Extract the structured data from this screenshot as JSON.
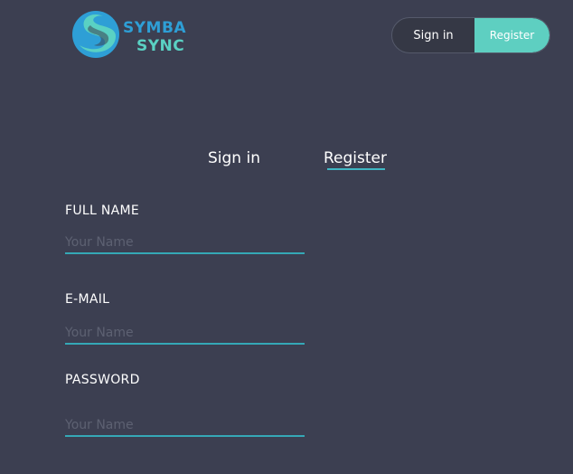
{
  "brand": {
    "line1": "SYMBA",
    "line2": "SYNC",
    "colors": {
      "blue": "#2e9fd6",
      "teal": "#5ad1c3",
      "background": "#3c3f51",
      "accent": "#35a8b6"
    }
  },
  "header_toggle": {
    "signin_label": "Sign in",
    "register_label": "Register",
    "active": "Register"
  },
  "tabs": {
    "signin_label": "Sign in",
    "register_label": "Register",
    "active": "Register"
  },
  "form": {
    "full_name": {
      "label": "FULL NAME",
      "placeholder": "Your Name",
      "value": ""
    },
    "email": {
      "label": "E-MAIL",
      "placeholder": "Your Name",
      "value": ""
    },
    "password": {
      "label": "PASSWORD",
      "placeholder": "Your Name",
      "value": ""
    }
  }
}
